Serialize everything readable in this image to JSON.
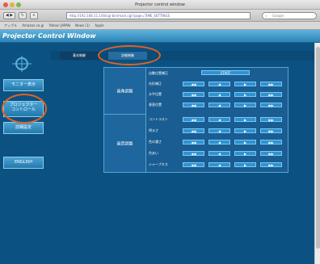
{
  "window": {
    "title": "Projector control window",
    "address": "http://192.168.11.100/cgi-bin/main.cgi?page=TIME_SETTINGS",
    "search_placeholder": "Google",
    "bookmarks": [
      "アップル",
      "Amazon.co.jp",
      "Yahoo! JAPAN",
      "News (1)",
      "Apple"
    ]
  },
  "app": {
    "title": "Projector Control Window",
    "colors": {
      "background": "#0b5283",
      "accent": "#2d93d3",
      "highlight": "#e2631f"
    }
  },
  "sidebar": {
    "items": [
      {
        "label": "モニター表示"
      },
      {
        "label_line1": "プロジェクター",
        "label_line2": "コントロール"
      },
      {
        "label": "詳細設定"
      },
      {
        "label": "ENGLISH"
      }
    ]
  },
  "tabs": [
    {
      "label": "基本制御"
    },
    {
      "label": "詳細制御"
    }
  ],
  "table": {
    "groups": [
      {
        "label": "画角調整"
      },
      {
        "label": "画質調整"
      }
    ],
    "rows": [
      {
        "label": "自動位置補正",
        "control": "START"
      },
      {
        "label": "台形補正"
      },
      {
        "label": "水平位置"
      },
      {
        "label": "垂直位置"
      },
      {
        "label": "コントラスト"
      },
      {
        "label": "明るさ"
      },
      {
        "label": "色の濃さ"
      },
      {
        "label": "色あい"
      },
      {
        "label": "シャープネス"
      }
    ],
    "controls": [
      "◀◀",
      "◀",
      "▶",
      "▶▶"
    ]
  }
}
